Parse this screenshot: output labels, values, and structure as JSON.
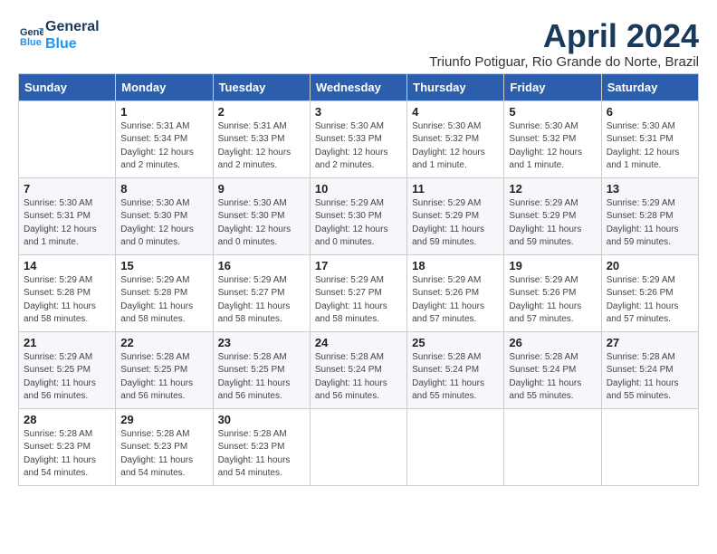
{
  "header": {
    "logo_line1": "General",
    "logo_line2": "Blue",
    "title": "April 2024",
    "location": "Triunfo Potiguar, Rio Grande do Norte, Brazil"
  },
  "columns": [
    "Sunday",
    "Monday",
    "Tuesday",
    "Wednesday",
    "Thursday",
    "Friday",
    "Saturday"
  ],
  "weeks": [
    [
      {
        "day": "",
        "info": ""
      },
      {
        "day": "1",
        "info": "Sunrise: 5:31 AM\nSunset: 5:34 PM\nDaylight: 12 hours\nand 2 minutes."
      },
      {
        "day": "2",
        "info": "Sunrise: 5:31 AM\nSunset: 5:33 PM\nDaylight: 12 hours\nand 2 minutes."
      },
      {
        "day": "3",
        "info": "Sunrise: 5:30 AM\nSunset: 5:33 PM\nDaylight: 12 hours\nand 2 minutes."
      },
      {
        "day": "4",
        "info": "Sunrise: 5:30 AM\nSunset: 5:32 PM\nDaylight: 12 hours\nand 1 minute."
      },
      {
        "day": "5",
        "info": "Sunrise: 5:30 AM\nSunset: 5:32 PM\nDaylight: 12 hours\nand 1 minute."
      },
      {
        "day": "6",
        "info": "Sunrise: 5:30 AM\nSunset: 5:31 PM\nDaylight: 12 hours\nand 1 minute."
      }
    ],
    [
      {
        "day": "7",
        "info": "Sunrise: 5:30 AM\nSunset: 5:31 PM\nDaylight: 12 hours\nand 1 minute."
      },
      {
        "day": "8",
        "info": "Sunrise: 5:30 AM\nSunset: 5:30 PM\nDaylight: 12 hours\nand 0 minutes."
      },
      {
        "day": "9",
        "info": "Sunrise: 5:30 AM\nSunset: 5:30 PM\nDaylight: 12 hours\nand 0 minutes."
      },
      {
        "day": "10",
        "info": "Sunrise: 5:29 AM\nSunset: 5:30 PM\nDaylight: 12 hours\nand 0 minutes."
      },
      {
        "day": "11",
        "info": "Sunrise: 5:29 AM\nSunset: 5:29 PM\nDaylight: 11 hours\nand 59 minutes."
      },
      {
        "day": "12",
        "info": "Sunrise: 5:29 AM\nSunset: 5:29 PM\nDaylight: 11 hours\nand 59 minutes."
      },
      {
        "day": "13",
        "info": "Sunrise: 5:29 AM\nSunset: 5:28 PM\nDaylight: 11 hours\nand 59 minutes."
      }
    ],
    [
      {
        "day": "14",
        "info": "Sunrise: 5:29 AM\nSunset: 5:28 PM\nDaylight: 11 hours\nand 58 minutes."
      },
      {
        "day": "15",
        "info": "Sunrise: 5:29 AM\nSunset: 5:28 PM\nDaylight: 11 hours\nand 58 minutes."
      },
      {
        "day": "16",
        "info": "Sunrise: 5:29 AM\nSunset: 5:27 PM\nDaylight: 11 hours\nand 58 minutes."
      },
      {
        "day": "17",
        "info": "Sunrise: 5:29 AM\nSunset: 5:27 PM\nDaylight: 11 hours\nand 58 minutes."
      },
      {
        "day": "18",
        "info": "Sunrise: 5:29 AM\nSunset: 5:26 PM\nDaylight: 11 hours\nand 57 minutes."
      },
      {
        "day": "19",
        "info": "Sunrise: 5:29 AM\nSunset: 5:26 PM\nDaylight: 11 hours\nand 57 minutes."
      },
      {
        "day": "20",
        "info": "Sunrise: 5:29 AM\nSunset: 5:26 PM\nDaylight: 11 hours\nand 57 minutes."
      }
    ],
    [
      {
        "day": "21",
        "info": "Sunrise: 5:29 AM\nSunset: 5:25 PM\nDaylight: 11 hours\nand 56 minutes."
      },
      {
        "day": "22",
        "info": "Sunrise: 5:28 AM\nSunset: 5:25 PM\nDaylight: 11 hours\nand 56 minutes."
      },
      {
        "day": "23",
        "info": "Sunrise: 5:28 AM\nSunset: 5:25 PM\nDaylight: 11 hours\nand 56 minutes."
      },
      {
        "day": "24",
        "info": "Sunrise: 5:28 AM\nSunset: 5:24 PM\nDaylight: 11 hours\nand 56 minutes."
      },
      {
        "day": "25",
        "info": "Sunrise: 5:28 AM\nSunset: 5:24 PM\nDaylight: 11 hours\nand 55 minutes."
      },
      {
        "day": "26",
        "info": "Sunrise: 5:28 AM\nSunset: 5:24 PM\nDaylight: 11 hours\nand 55 minutes."
      },
      {
        "day": "27",
        "info": "Sunrise: 5:28 AM\nSunset: 5:24 PM\nDaylight: 11 hours\nand 55 minutes."
      }
    ],
    [
      {
        "day": "28",
        "info": "Sunrise: 5:28 AM\nSunset: 5:23 PM\nDaylight: 11 hours\nand 54 minutes."
      },
      {
        "day": "29",
        "info": "Sunrise: 5:28 AM\nSunset: 5:23 PM\nDaylight: 11 hours\nand 54 minutes."
      },
      {
        "day": "30",
        "info": "Sunrise: 5:28 AM\nSunset: 5:23 PM\nDaylight: 11 hours\nand 54 minutes."
      },
      {
        "day": "",
        "info": ""
      },
      {
        "day": "",
        "info": ""
      },
      {
        "day": "",
        "info": ""
      },
      {
        "day": "",
        "info": ""
      }
    ]
  ]
}
